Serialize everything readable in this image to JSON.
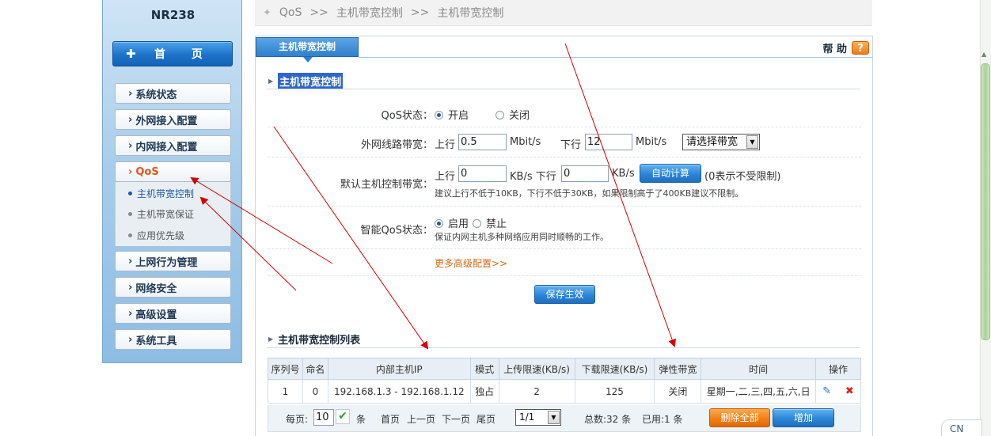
{
  "sidebar": {
    "model": "NR238",
    "home_label": "首 页",
    "nav": [
      {
        "label": "系统状态"
      },
      {
        "label": "外网接入配置"
      },
      {
        "label": "内网接入配置"
      },
      {
        "label": "QoS"
      },
      {
        "label": "上网行为管理"
      },
      {
        "label": "网络安全"
      },
      {
        "label": "高级设置"
      },
      {
        "label": "系统工具"
      }
    ],
    "qos_sub": [
      "主机带宽控制",
      "主机带宽保证",
      "应用优先级"
    ]
  },
  "breadcrumb": {
    "root": "QoS",
    "sep": ">>",
    "level1": "主机带宽控制",
    "level2": "主机带宽控制"
  },
  "panel": {
    "tab_label": "主机带宽控制",
    "help_label": "帮 助",
    "help_icon": "?",
    "section1_title": "主机带宽控制",
    "qos_status_label": "QoS状态：",
    "qos_on": "开启",
    "qos_off": "关闭",
    "wan_bw_label": "外网线路带宽：",
    "upload_label": "上行",
    "upload_value": "0.5",
    "unit_mbit": "Mbit/s",
    "download_label": "下行",
    "download_value": "12",
    "bw_select": "请选择带宽",
    "default_host_label": "默认主机控制带宽：",
    "default_up_value": "0",
    "unit_kb": "KB/s",
    "default_down_label": "KB/s 下行",
    "default_down_value": "0",
    "auto_calc_button": "自动计算",
    "zero_note": "(0表示不受限制)",
    "default_hint": "建议上行不低于10KB，下行不低于30KB，如果限制高于了400KB建议不限制。",
    "smart_qos_label": "智能QoS状态：",
    "smart_on": "启用",
    "smart_off": "禁止",
    "smart_hint": "保证内网主机多种网络应用同时顺畅的工作。",
    "more_config": "更多高级配置>>",
    "save_button": "保存生效",
    "section2_title": "主机带宽控制列表"
  },
  "table": {
    "headers": [
      "序列号",
      "命名",
      "内部主机IP",
      "模式",
      "上传限速(KB/s)",
      "下载限速(KB/s)",
      "弹性带宽",
      "时间",
      "操作"
    ],
    "rows": [
      [
        "1",
        "0",
        "192.168.1.3 - 192.168.1.12",
        "独占",
        "2",
        "125",
        "关闭",
        "星期一,二,三,四,五,六,日"
      ]
    ]
  },
  "pager": {
    "per_page_label": "每页:",
    "per_page_value": "10",
    "per_page_unit": "条",
    "first": "首页",
    "prev": "上一页",
    "next": "下一页",
    "last": "尾页",
    "page_select": "1/1",
    "total": "总数:32 条",
    "used": "已用:1 条",
    "delete_all": "删除全部",
    "add": "增加"
  },
  "badge": "CN",
  "colors": {
    "accent": "#2c85d6",
    "active_nav": "#e0561a",
    "arrow": "#d60000"
  }
}
